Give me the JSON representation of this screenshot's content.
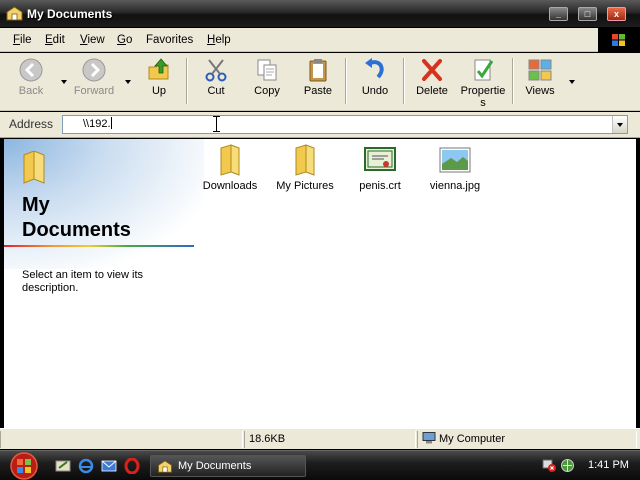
{
  "window": {
    "title": "My Documents",
    "buttons": {
      "minimize": "_",
      "maximize": "□",
      "close": "x"
    }
  },
  "menu": [
    {
      "key": "F",
      "rest": "ile"
    },
    {
      "key": "E",
      "rest": "dit"
    },
    {
      "key": "V",
      "rest": "iew"
    },
    {
      "key": "G",
      "rest": "o"
    },
    {
      "key": "",
      "rest": "Favorites"
    },
    {
      "key": "H",
      "rest": "elp"
    }
  ],
  "toolbar": {
    "back": "Back",
    "forward": "Forward",
    "up": "Up",
    "cut": "Cut",
    "copy": "Copy",
    "paste": "Paste",
    "undo": "Undo",
    "delete": "Delete",
    "properties_line1": "Propertie",
    "properties_line2": "s",
    "views": "Views"
  },
  "address": {
    "label": "Address",
    "value": "\\\\192."
  },
  "taskpane": {
    "title_line1": "My",
    "title_line2": "Documents",
    "description": "Select an item to view its description."
  },
  "files": [
    {
      "name": "Downloads",
      "icon": "folder-icon"
    },
    {
      "name": "My Pictures",
      "icon": "folder-icon"
    },
    {
      "name": "penis.crt",
      "icon": "certificate-icon"
    },
    {
      "name": "vienna.jpg",
      "icon": "image-icon"
    }
  ],
  "statusbar": {
    "size": "18.6KB",
    "zone": "My Computer"
  },
  "taskbar": {
    "task_label": "My Documents",
    "clock": "1:41 PM"
  },
  "colors": {
    "accent_blue": "#3a6fd0",
    "window_bg": "#ece9d8",
    "folder_yellow": "#f2c94c"
  }
}
